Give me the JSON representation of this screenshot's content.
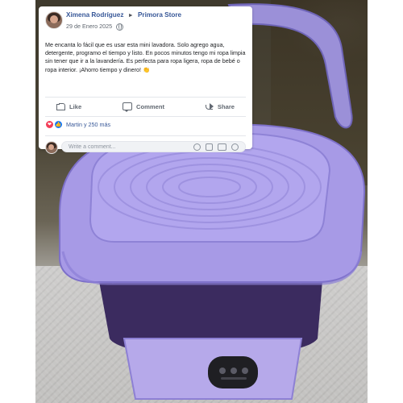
{
  "post": {
    "author": "Ximena Rodríguez",
    "page": "Primora Store",
    "date": "29 de Enero 2025",
    "text": "Me encanta lo fácil que es usar esta mini lavadora. Solo agrego agua, detergente, programo el tiempo y listo. En pocos minutos tengo mi ropa limpia sin tener que ir a la lavandería. Es perfecta para ropa ligera, ropa de bebé o ropa interior. ¡Ahorro tiempo y dinero! 👏",
    "actions": {
      "like": "Like",
      "comment": "Comment",
      "share": "Share"
    },
    "reactions": {
      "summary": "Martin y 250 más"
    },
    "comment_box": {
      "placeholder": "Write a comment..."
    }
  },
  "ui": {
    "icons": [
      "globe-icon",
      "like-icon",
      "comment-icon",
      "share-icon",
      "love-reaction-icon",
      "like-reaction-icon",
      "emoji-icon",
      "camera-icon",
      "gif-icon",
      "sticker-icon"
    ],
    "colors": {
      "link": "#385898",
      "muted": "#606770",
      "text": "#1c1e21",
      "divider": "#e4e6eb",
      "love": "#f33e58",
      "like": "#1877f2",
      "washer_purple": "#9b90d8",
      "washer_dark": "#3b2b5f"
    }
  }
}
